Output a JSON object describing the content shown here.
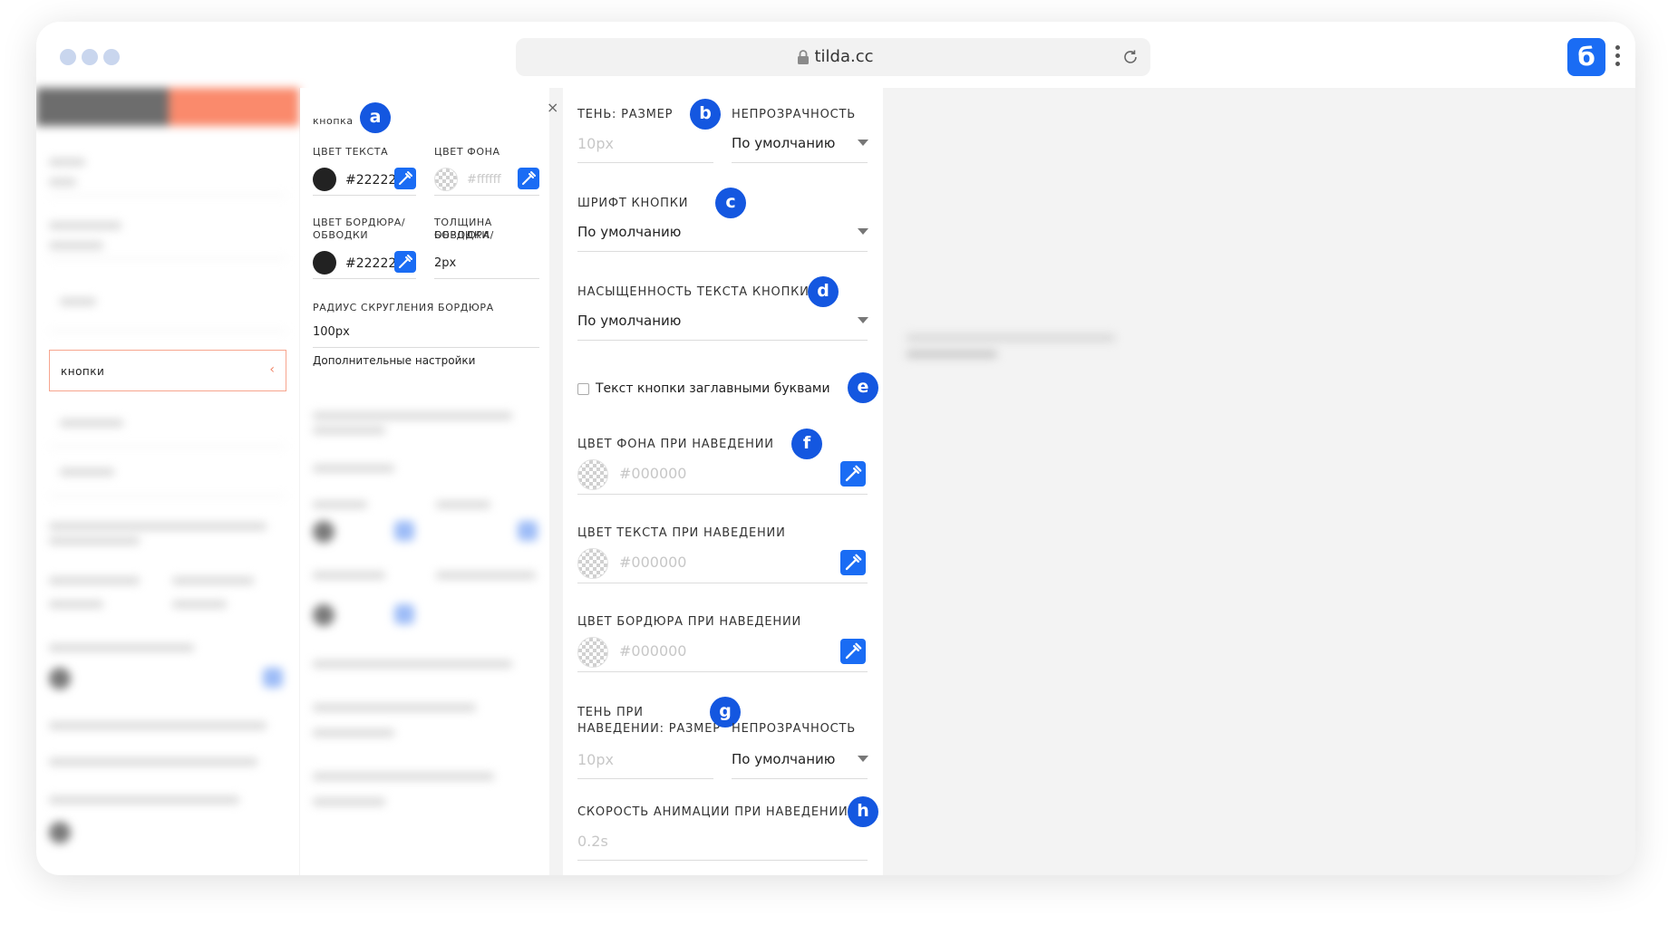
{
  "browser": {
    "url": "tilda.cc",
    "extension_letter": "б"
  },
  "left_menu": {
    "active_item": "кнопки",
    "chevron": "‹"
  },
  "button_panel": {
    "title": "кнопка",
    "badge": "a",
    "text_color_label": "ЦВЕТ ТЕКСТА",
    "text_color_value": "#222222",
    "bg_color_label": "ЦВЕТ ФОНА",
    "bg_color_placeholder": "#ffffff",
    "border_color_label_1": "ЦВЕТ БОРДЮРА/",
    "border_color_label_2": "ОБВОДКИ",
    "border_color_value": "#222222",
    "border_width_label_1": "ТОЛЩИНА БОРДЮРА/",
    "border_width_label_2": "ОБВОДКИ",
    "border_width_value": "2px",
    "radius_label": "РАДИУС СКРУГЛЕНИЯ БОРДЮРА",
    "radius_value": "100px",
    "advanced_label": "Дополнительные настройки",
    "close": "×"
  },
  "advanced_panel": {
    "shadow_size_label": "ТЕНЬ: РАЗМЕР",
    "shadow_size_placeholder": "10px",
    "shadow_opacity_label": "НЕПРОЗРАЧНОСТЬ",
    "shadow_opacity_value": "По умолчанию",
    "badge_b": "b",
    "font_label": "ШРИФТ КНОПКИ",
    "font_value": "По умолчанию",
    "badge_c": "c",
    "weight_label": "НАСЫЩЕННОСТЬ ТЕКСТА КНОПКИ",
    "weight_value": "По умолчанию",
    "badge_d": "d",
    "uppercase_label": "Текст кнопки заглавными буквами",
    "badge_e": "e",
    "hover_bg_label": "ЦВЕТ ФОНА ПРИ НАВЕДЕНИИ",
    "hover_bg_placeholder": "#000000",
    "badge_f": "f",
    "hover_text_label": "ЦВЕТ ТЕКСТА ПРИ НАВЕДЕНИИ",
    "hover_text_placeholder": "#000000",
    "hover_border_label": "ЦВЕТ БОРДЮРА ПРИ НАВЕДЕНИИ",
    "hover_border_placeholder": "#000000",
    "hover_shadow_label_1": "ТЕНЬ ПРИ",
    "hover_shadow_label_2": "НАВЕДЕНИИ: РАЗМЕР",
    "hover_shadow_placeholder": "10px",
    "hover_opacity_label": "НЕПРОЗРАЧНОСТЬ",
    "hover_opacity_value": "По умолчанию",
    "badge_g": "g",
    "anim_label": "СКОРОСТЬ АНИМАЦИИ ПРИ НАВЕДЕНИИ",
    "anim_placeholder": "0.2s",
    "badge_h": "h"
  },
  "colors": {
    "accent": "#1a6cf4",
    "badge": "#1457e0",
    "orange": "#fa8a6c"
  },
  "icons": [
    "lock-icon",
    "reload-icon",
    "kebab-menu-icon",
    "eyedropper-icon",
    "close-icon",
    "dropdown-arrow-icon"
  ]
}
